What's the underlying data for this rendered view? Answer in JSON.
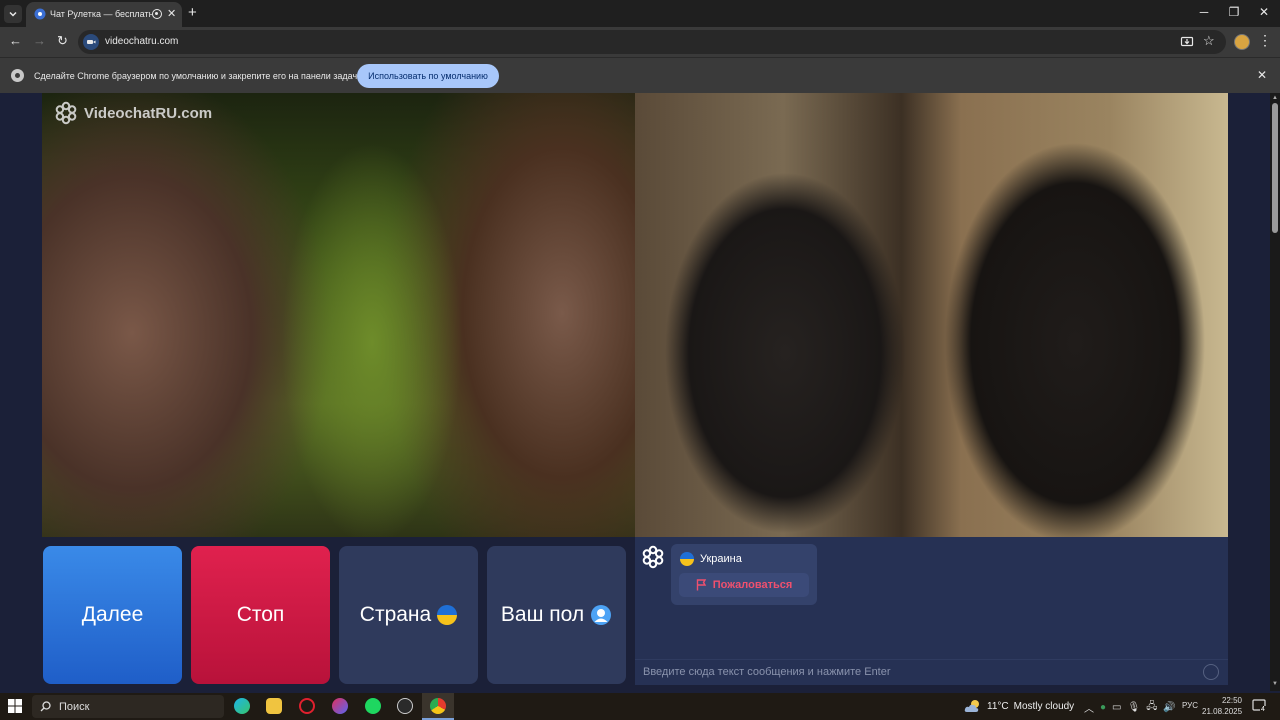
{
  "browser": {
    "tab_title": "Чат Рулетка — бесплатный",
    "url": "videochatru.com"
  },
  "infobar": {
    "text": "Сделайте Chrome браузером по умолчанию и закрепите его на панели задач.",
    "button_label": "Использовать по умолчанию"
  },
  "site": {
    "logo_text": "VideochatRU.com"
  },
  "controls": {
    "next_label": "Далее",
    "stop_label": "Стоп",
    "country_label": "Страна",
    "gender_label": "Ваш пол"
  },
  "chat": {
    "partner_country": "Украина",
    "report_label": "Пожаловаться",
    "input_placeholder": "Введите сюда текст сообщения и нажмите Enter"
  },
  "taskbar": {
    "search_label": "Поиск",
    "temperature": "11°C",
    "weather": "Mostly cloudy",
    "language": "РУС",
    "time": "22:50",
    "date": "21.08.2025",
    "notification_count": "4"
  },
  "colors": {
    "next_button": "#2f74dc",
    "stop_button": "#d01a45",
    "secondary_button": "#2f3a5c",
    "chat_panel": "#263154",
    "report_text": "#f0506e",
    "default_button": "#a8c7fa"
  }
}
